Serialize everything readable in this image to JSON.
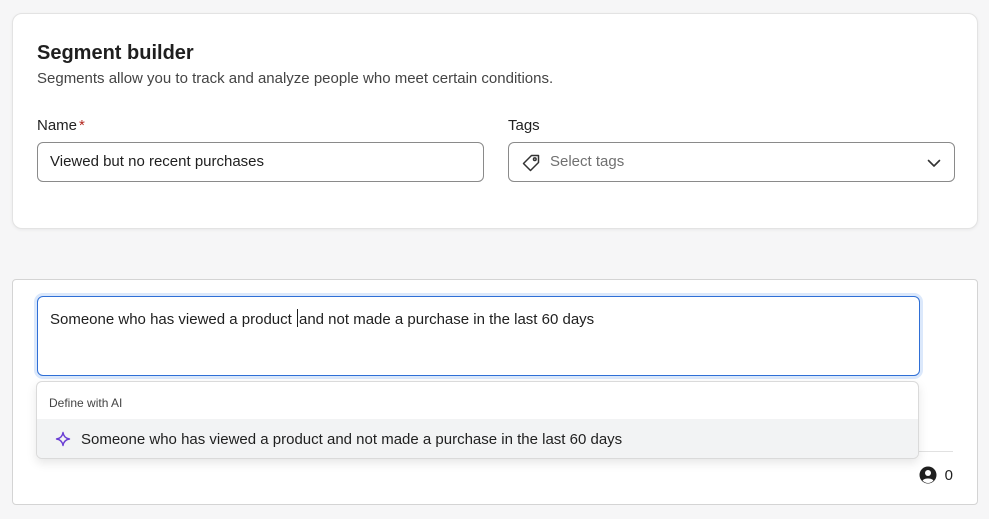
{
  "header": {
    "title": "Segment builder",
    "subtitle": "Segments allow you to track and analyze people who meet certain conditions."
  },
  "form": {
    "name_label": "Name",
    "required_mark": "*",
    "name_value": "Viewed but no recent purchases",
    "tags_label": "Tags",
    "tags_placeholder": "Select tags",
    "tags_icon": "tag-icon",
    "tags_dropdown_icon": "chevron-down-icon"
  },
  "ai": {
    "input_before_caret": "Someone who has viewed a product ",
    "input_after_caret": "and not made a purchase in the last 60 days",
    "dropdown_header": "Define with AI",
    "suggestion": "Someone who has viewed a product and not made a purchase in the last 60 days",
    "suggestion_icon": "sparkle-icon",
    "accent_color": "#6b3fd4"
  },
  "footer": {
    "count_icon": "person-icon",
    "count": "0"
  }
}
